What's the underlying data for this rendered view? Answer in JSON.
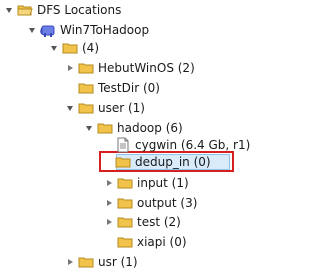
{
  "tree": {
    "root": {
      "label": "DFS Locations"
    },
    "location": {
      "label": "Win7ToHadoop"
    },
    "top_folder": {
      "label": "(4)"
    },
    "items": [
      {
        "label": "HebutWinOS (2)"
      },
      {
        "label": "TestDir (0)"
      },
      {
        "label": "user (1)"
      },
      {
        "label": "hadoop (6)"
      },
      {
        "label": "cygwin (6.4 Gb, r1)"
      },
      {
        "label": "dedup_in (0)"
      },
      {
        "label": "input (1)"
      },
      {
        "label": "output (3)"
      },
      {
        "label": "test (2)"
      },
      {
        "label": "xiapi (0)"
      },
      {
        "label": "usr (1)"
      }
    ]
  },
  "colors": {
    "folder": "#f1c34a",
    "highlight_border": "#d61f1f",
    "selection_fill": "#d9ebf9"
  }
}
